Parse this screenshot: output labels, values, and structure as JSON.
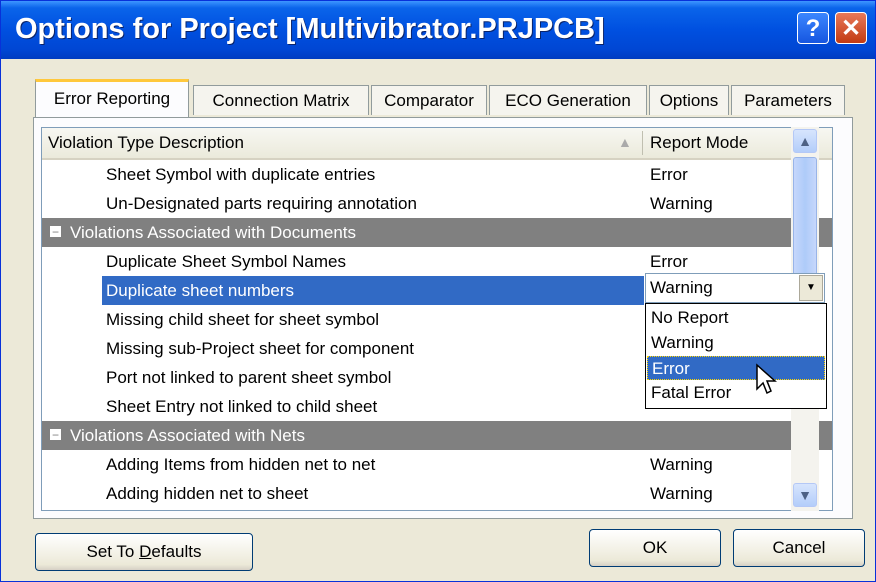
{
  "window": {
    "title": "Options for Project [Multivibrator.PRJPCB]",
    "help_glyph": "?",
    "close_glyph": "✕"
  },
  "tabs": [
    {
      "label": "Error Reporting",
      "active": true
    },
    {
      "label": "Connection Matrix",
      "active": false
    },
    {
      "label": "Comparator",
      "active": false
    },
    {
      "label": "ECO Generation",
      "active": false
    },
    {
      "label": "Options",
      "active": false
    },
    {
      "label": "Parameters",
      "active": false
    }
  ],
  "list": {
    "col_description": "Violation Type Description",
    "col_mode": "Report Mode",
    "rows": [
      {
        "type": "item",
        "desc": "Sheet Symbol with duplicate entries",
        "mode": "Error"
      },
      {
        "type": "item",
        "desc": "Un-Designated parts requiring annotation",
        "mode": "Warning"
      },
      {
        "type": "group",
        "desc": "Violations Associated with Documents",
        "mode": ""
      },
      {
        "type": "item",
        "desc": "Duplicate Sheet Symbol Names",
        "mode": "Error"
      },
      {
        "type": "selected",
        "desc": "Duplicate sheet numbers",
        "mode": ""
      },
      {
        "type": "item",
        "desc": "Missing child sheet for sheet symbol",
        "mode": ""
      },
      {
        "type": "item",
        "desc": "Missing sub-Project sheet for component",
        "mode": ""
      },
      {
        "type": "item",
        "desc": "Port not linked to parent sheet symbol",
        "mode": ""
      },
      {
        "type": "item",
        "desc": "Sheet Entry not linked to child sheet",
        "mode": ""
      },
      {
        "type": "group",
        "desc": "Violations Associated with Nets",
        "mode": ""
      },
      {
        "type": "item",
        "desc": "Adding Items from hidden net to net",
        "mode": "Warning"
      },
      {
        "type": "item",
        "desc": "Adding hidden net to sheet",
        "mode": "Warning"
      }
    ]
  },
  "combo": {
    "value": "Warning",
    "options": [
      "No Report",
      "Warning",
      "Error",
      "Fatal Error"
    ],
    "highlighted": "Error"
  },
  "buttons": {
    "defaults_prefix": "Set To ",
    "defaults_underlined": "D",
    "defaults_suffix": "efaults",
    "ok": "OK",
    "cancel": "Cancel"
  },
  "colors": {
    "selection": "#316ac5",
    "group_row": "#808080",
    "title_bar": "#0050e0"
  }
}
